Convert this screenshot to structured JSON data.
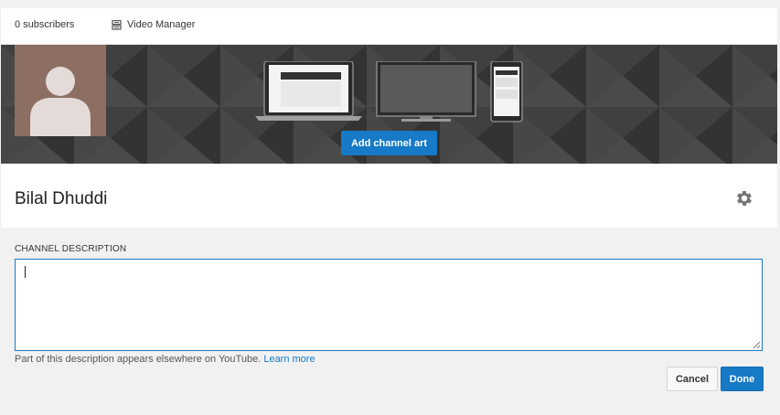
{
  "header": {
    "subscribers": "0 subscribers",
    "video_manager": "Video Manager",
    "video_manager_icon": "video-manager-icon"
  },
  "banner": {
    "add_channel_art_label": "Add channel art",
    "background_color": "#3d3d3d",
    "avatar_color": "#8d6e63",
    "devices": [
      "laptop-icon",
      "tv-icon",
      "phone-icon"
    ]
  },
  "channel": {
    "name": "Bilal Dhuddi",
    "settings_icon": "gear-icon"
  },
  "description": {
    "label": "CHANNEL DESCRIPTION",
    "value": "",
    "help_text": "Part of this description appears elsewhere on YouTube.",
    "learn_more": "Learn more"
  },
  "actions": {
    "cancel_label": "Cancel",
    "done_label": "Done"
  },
  "colors": {
    "accent": "#167ac6",
    "link": "#167ac6"
  }
}
